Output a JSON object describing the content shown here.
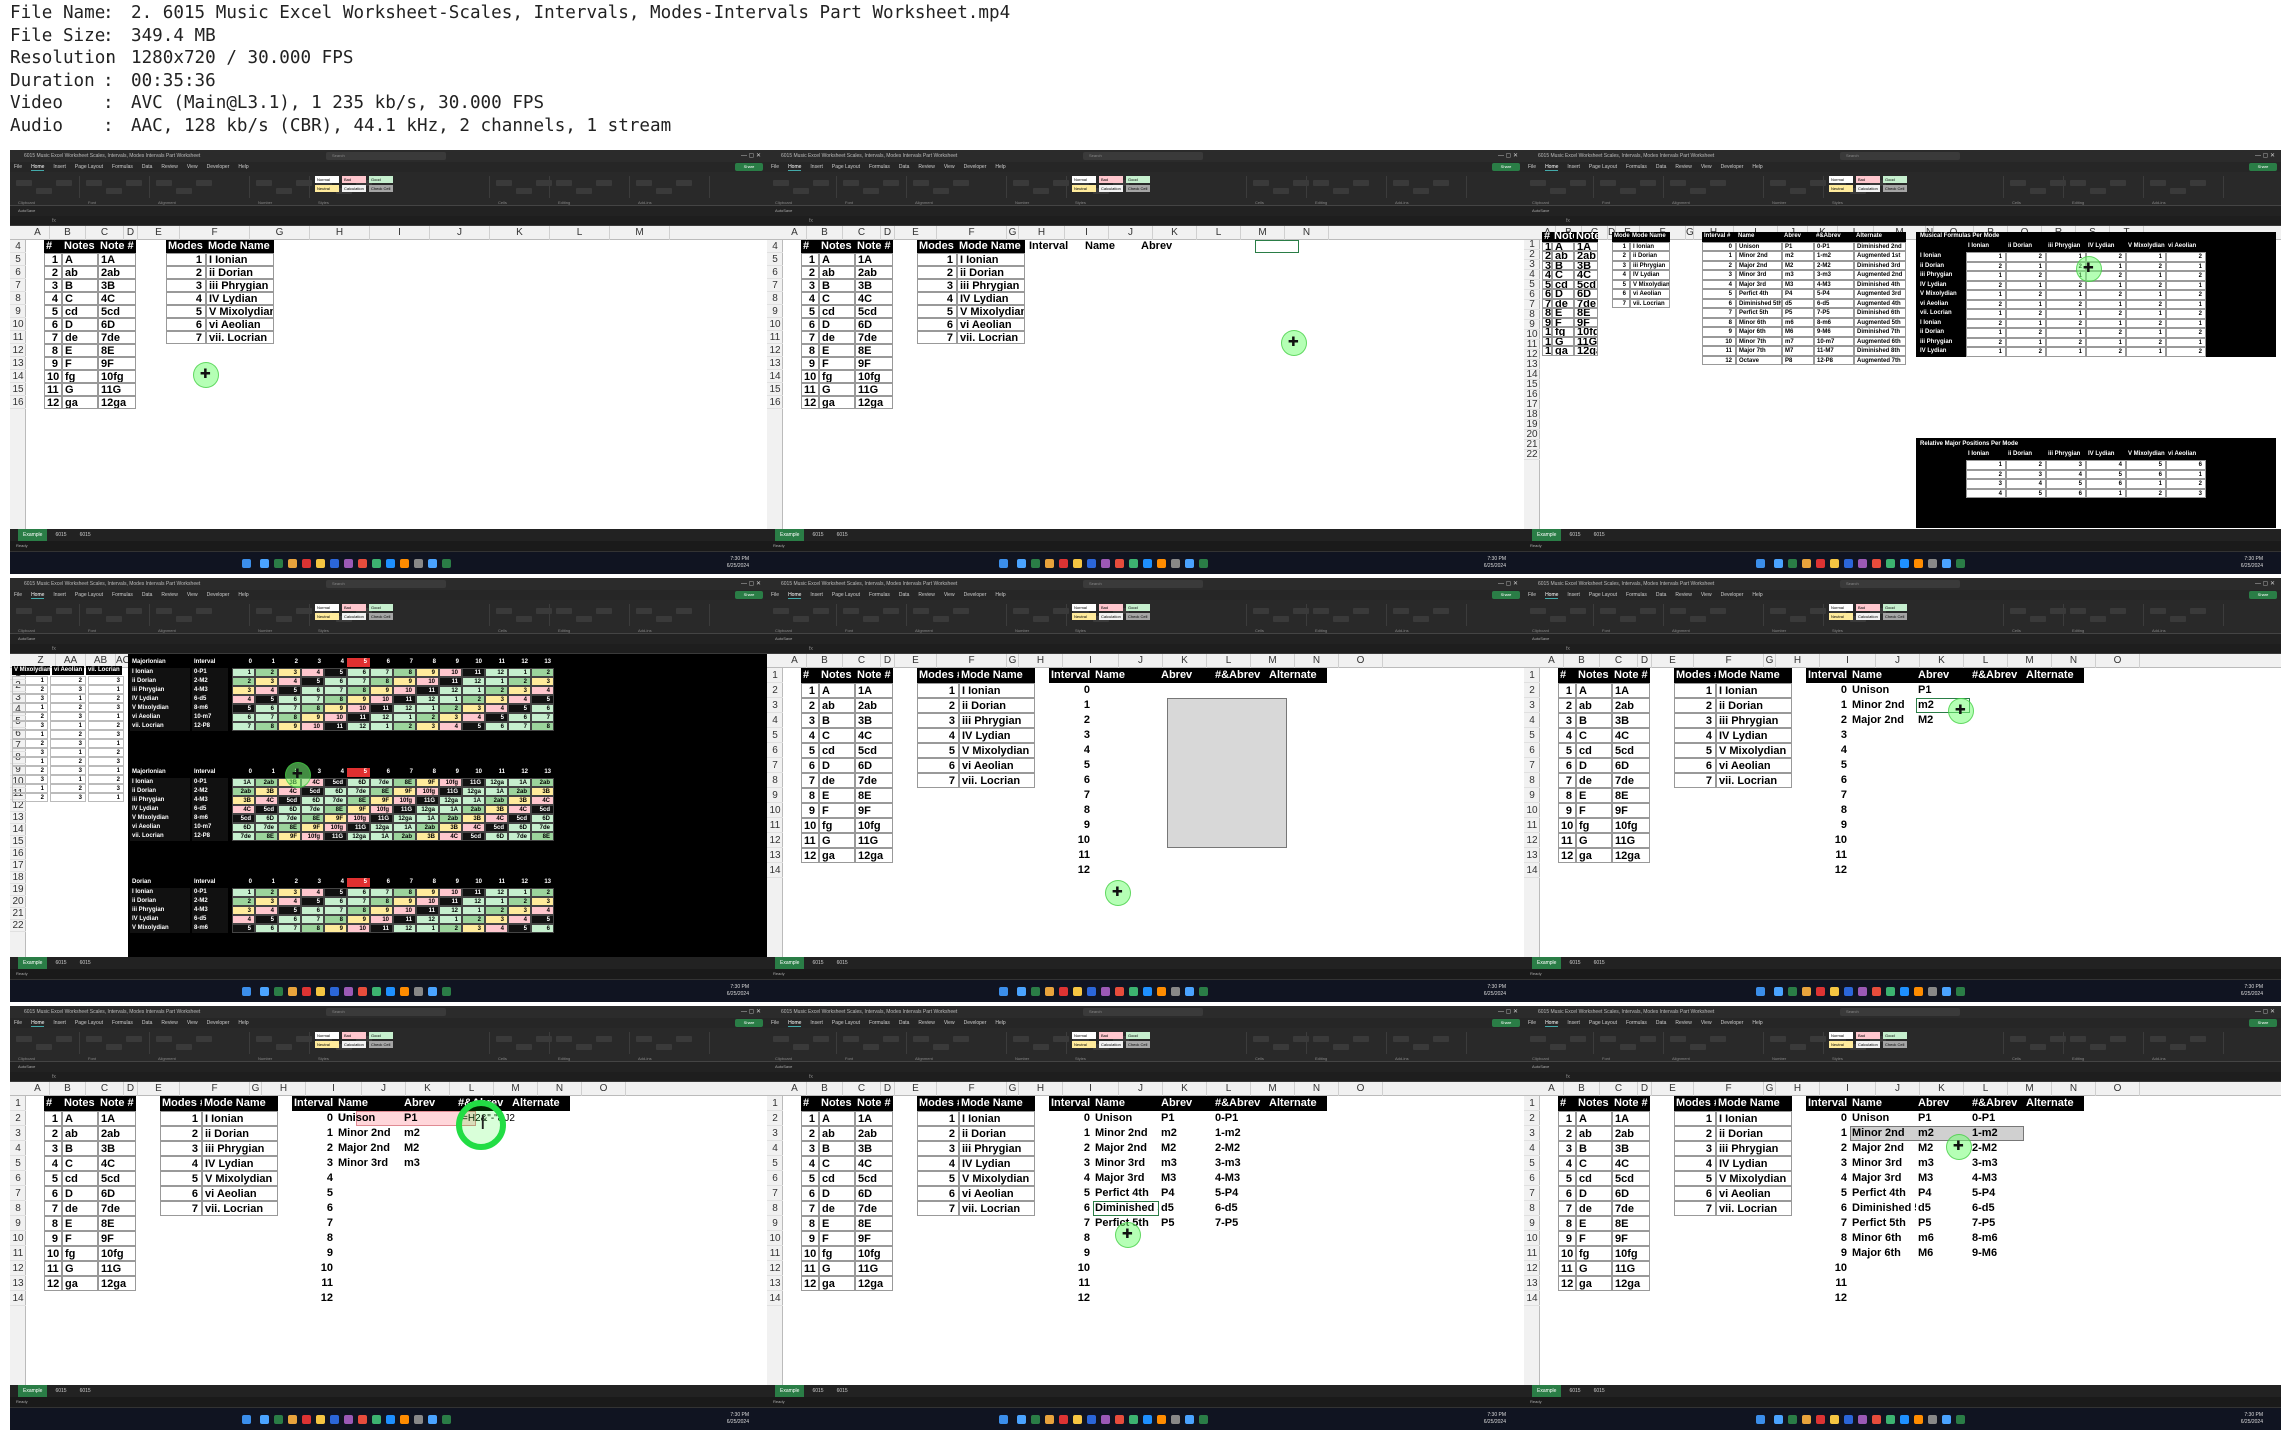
{
  "header": {
    "lines": [
      {
        "key": "File Name",
        "value": "2. 6015 Music Excel Worksheet-Scales, Intervals, Modes-Intervals Part Worksheet.mp4"
      },
      {
        "key": "File Size",
        "value": "349.4 MB"
      },
      {
        "key": "Resolution",
        "value": "1280x720 / 30.000 FPS"
      },
      {
        "key": "Duration",
        "value": "00:35:36"
      },
      {
        "key": "Video",
        "value": "AVC (Main@L3.1), 1 235 kb/s, 30.000 FPS"
      },
      {
        "key": "Audio",
        "value": "AAC, 128 kb/s (CBR), 44.1 kHz, 2 channels, 1 stream"
      }
    ],
    "colon": ":"
  },
  "excel": {
    "title": "6015 Music Excel Worksheet Scales, Intervals, Modes Intervals Part Worksheet",
    "search_placeholder": "Search",
    "user": "Bob Streb",
    "menu": [
      "File",
      "Home",
      "Insert",
      "Page Layout",
      "Formulas",
      "Data",
      "Review",
      "View",
      "Developer",
      "Help"
    ],
    "share": "Share",
    "comments": "Comments",
    "styles": [
      "Normal",
      "Bad",
      "Good",
      "Neutral",
      "Calculation",
      "Check Cell"
    ],
    "ribbon_groups": [
      "Clipboard",
      "Font",
      "Alignment",
      "Number",
      "Styles",
      "Cells",
      "Editing",
      "Add-ins"
    ],
    "autosave": "AutoSave",
    "sheets": [
      "Example",
      "6015",
      "6015"
    ],
    "status": "Ready",
    "accessibility": "Accessibility: Investigate",
    "display_settings": "Display Settings",
    "taskbar_search": "Search",
    "time": "7:30 PM",
    "date": "6/25/2024"
  },
  "notes": {
    "header": [
      "#",
      "Notes",
      "Note #"
    ],
    "rows": [
      [
        "1",
        "A",
        "1A"
      ],
      [
        "2",
        "ab",
        "2ab"
      ],
      [
        "3",
        "B",
        "3B"
      ],
      [
        "4",
        "C",
        "4C"
      ],
      [
        "5",
        "cd",
        "5cd"
      ],
      [
        "6",
        "D",
        "6D"
      ],
      [
        "7",
        "de",
        "7de"
      ],
      [
        "8",
        "E",
        "8E"
      ],
      [
        "9",
        "F",
        "9F"
      ],
      [
        "10",
        "fg",
        "10fg"
      ],
      [
        "11",
        "G",
        "11G"
      ],
      [
        "12",
        "ga",
        "12ga"
      ]
    ]
  },
  "modes": {
    "header": [
      "Modes #",
      "Mode Name"
    ],
    "rows": [
      [
        "1",
        "I Ionian"
      ],
      [
        "2",
        "ii Dorian"
      ],
      [
        "3",
        "iii Phrygian"
      ],
      [
        "4",
        "IV Lydian"
      ],
      [
        "5",
        "V Mixolydian"
      ],
      [
        "6",
        "vi Aeolian"
      ],
      [
        "7",
        "vii. Locrian"
      ]
    ]
  },
  "intervals": {
    "header": [
      "Interval #",
      "Name",
      "Abrev",
      "#&Abrev",
      "Alternate"
    ],
    "numbers": [
      "0",
      "1",
      "2",
      "3",
      "4",
      "5",
      "6",
      "7",
      "8",
      "9",
      "10",
      "11",
      "12"
    ],
    "names": [
      "Unison",
      "Minor 2nd",
      "Major 2nd",
      "Minor 3rd",
      "Major 3rd",
      "Perfict 4th",
      "Diminished 5th",
      "Perfict 5th",
      "Minor 6th",
      "Major 6th",
      "Minor 7th",
      "Major 7th",
      "Octave"
    ],
    "abrevs": [
      "P1",
      "m2",
      "M2",
      "m3",
      "M3",
      "P4",
      "d5",
      "P5",
      "m6",
      "M6",
      "m7",
      "M7",
      "P8"
    ],
    "num_abrevs": [
      "0-P1",
      "1-m2",
      "2-M2",
      "3-m3",
      "4-M3",
      "5-P4",
      "6-d5",
      "7-P5",
      "8-m6",
      "9-M6",
      "10-m7",
      "11-M7",
      "12-P8"
    ],
    "alternates": [
      "Diminished 2nd",
      "Augmented 1st",
      "Diminished 3rd",
      "Augmented 2nd",
      "Diminished 4th",
      "Augmented 3rd",
      "Augmented 4th",
      "Diminished 6th",
      "Augmented 5th",
      "Diminished 7th",
      "Augmented 6th",
      "Diminished 8th",
      "Augmented 7th"
    ]
  },
  "formula_text": "=H2&\"-\"&J2",
  "formula_bar": "=VLOOKUP(AH$12&$AB13,$AP:$BS,2)",
  "tile1_cols": [
    "A",
    "B",
    "C",
    "D",
    "E",
    "F",
    "G",
    "H",
    "I",
    "J",
    "K",
    "L",
    "M"
  ],
  "tile2_cols": [
    "A",
    "B",
    "C",
    "D",
    "E",
    "F",
    "G",
    "H",
    "I",
    "J",
    "K",
    "L",
    "M",
    "N"
  ],
  "tile_cols_wide": [
    "A",
    "B",
    "C",
    "D",
    "E",
    "F",
    "G",
    "H",
    "I",
    "J",
    "K",
    "L",
    "M",
    "N",
    "O"
  ],
  "tile3": {
    "title_formulas": "Musical Formulas Per Mode",
    "title_positions": "Relative Major Positions Per Mode",
    "mode_cols": [
      "I Ionian",
      "ii Dorian",
      "iii Phrygian",
      "IV Lydian",
      "V Mixolydian",
      "vi Aeolian"
    ]
  },
  "tile4": {
    "labels": [
      "V Mixolydian",
      "vi Aeolian",
      "vii. Locrian"
    ],
    "block1": "MajorIonian",
    "block2": "MajorIonian",
    "block3": "Dorian",
    "interval_label": "Interval"
  }
}
